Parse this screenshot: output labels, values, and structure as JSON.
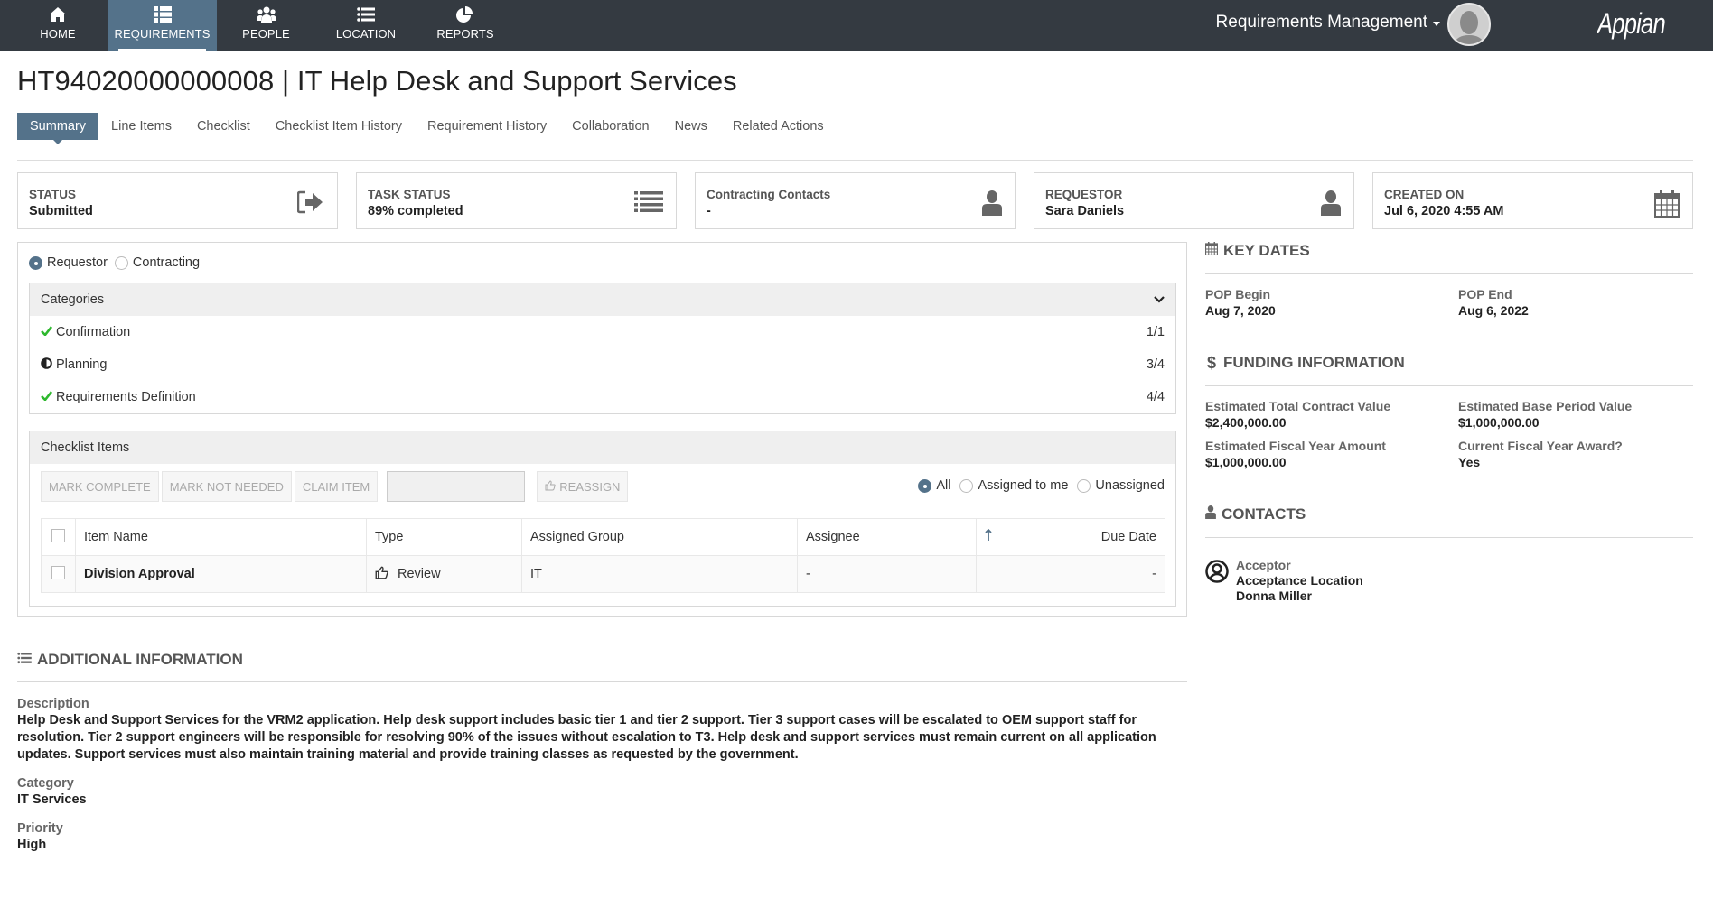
{
  "nav": {
    "items": [
      {
        "label": "HOME",
        "icon": "home-icon"
      },
      {
        "label": "REQUIREMENTS",
        "icon": "list-icon",
        "active": true
      },
      {
        "label": "PEOPLE",
        "icon": "people-icon"
      },
      {
        "label": "LOCATION",
        "icon": "bullet-list-icon"
      },
      {
        "label": "REPORTS",
        "icon": "pie-chart-icon"
      }
    ],
    "app_name": "Requirements Management",
    "logo": "Appian"
  },
  "page": {
    "title": "HT94020000000008 | IT Help Desk and Support Services",
    "tabs": [
      "Summary",
      "Line Items",
      "Checklist",
      "Checklist Item History",
      "Requirement History",
      "Collaboration",
      "News",
      "Related Actions"
    ],
    "active_tab": "Summary"
  },
  "cards": [
    {
      "label": "STATUS",
      "value": "Submitted",
      "icon": "sign-out-icon"
    },
    {
      "label": "TASK STATUS",
      "value": "89% completed",
      "icon": "list-icon"
    },
    {
      "label": "Contracting Contacts",
      "value": "-",
      "icon": "user-icon"
    },
    {
      "label": "REQUESTOR",
      "value": "Sara Daniels",
      "icon": "user-icon"
    },
    {
      "label": "CREATED ON",
      "value": "Jul 6, 2020 4:55 AM",
      "icon": "calendar-icon"
    }
  ],
  "view_toggle": {
    "options": [
      "Requestor",
      "Contracting"
    ],
    "selected": "Requestor"
  },
  "categories": {
    "header": "Categories",
    "items": [
      {
        "name": "Confirmation",
        "status": "complete",
        "count": "1/1"
      },
      {
        "name": "Planning",
        "status": "partial",
        "count": "3/4"
      },
      {
        "name": "Requirements Definition",
        "status": "complete",
        "count": "4/4"
      }
    ]
  },
  "checklist": {
    "header": "Checklist Items",
    "buttons": {
      "mark_complete": "MARK COMPLETE",
      "mark_not_needed": "MARK NOT NEEDED",
      "claim_item": "CLAIM ITEM",
      "reassign": "REASSIGN"
    },
    "filter": {
      "options": [
        "All",
        "Assigned to me",
        "Unassigned"
      ],
      "selected": "All"
    },
    "columns": [
      "Item Name",
      "Type",
      "Assigned Group",
      "Assignee",
      "Due Date"
    ],
    "rows": [
      {
        "item_name": "Division Approval",
        "type": "Review",
        "assigned_group": "IT",
        "assignee": "-",
        "due_date": "-"
      }
    ]
  },
  "key_dates": {
    "heading": "KEY DATES",
    "pop_begin_label": "POP Begin",
    "pop_begin": "Aug 7, 2020",
    "pop_end_label": "POP End",
    "pop_end": "Aug 6, 2022"
  },
  "funding": {
    "heading": "FUNDING INFORMATION",
    "fields": [
      {
        "label": "Estimated Total Contract Value",
        "value": "$2,400,000.00"
      },
      {
        "label": "Estimated Base Period Value",
        "value": "$1,000,000.00"
      },
      {
        "label": "Estimated Fiscal Year Amount",
        "value": "$1,000,000.00"
      },
      {
        "label": "Current Fiscal Year Award?",
        "value": "Yes"
      }
    ]
  },
  "contacts": {
    "heading": "CONTACTS",
    "items": [
      {
        "role": "Acceptor",
        "location": "Acceptance Location",
        "name": "Donna Miller"
      }
    ]
  },
  "additional": {
    "heading": "ADDITIONAL INFORMATION",
    "description_label": "Description",
    "description": "Help Desk and Support Services for the VRM2 application. Help desk support includes basic tier 1 and tier 2 support. Tier 3 support cases will be escalated to OEM support staff for resolution. Tier 2 support engineers will be responsible for resolving 90% of the issues without escalation to T3. Help desk and support services must remain current on all application updates. Support services must also maintain training material and provide training classes as requested by the government.",
    "category_label": "Category",
    "category": "IT Services",
    "priority_label": "Priority",
    "priority": "High"
  },
  "colors": {
    "nav_bg": "#343a41",
    "accent": "#54728a",
    "check_green": "#2eb82e"
  }
}
